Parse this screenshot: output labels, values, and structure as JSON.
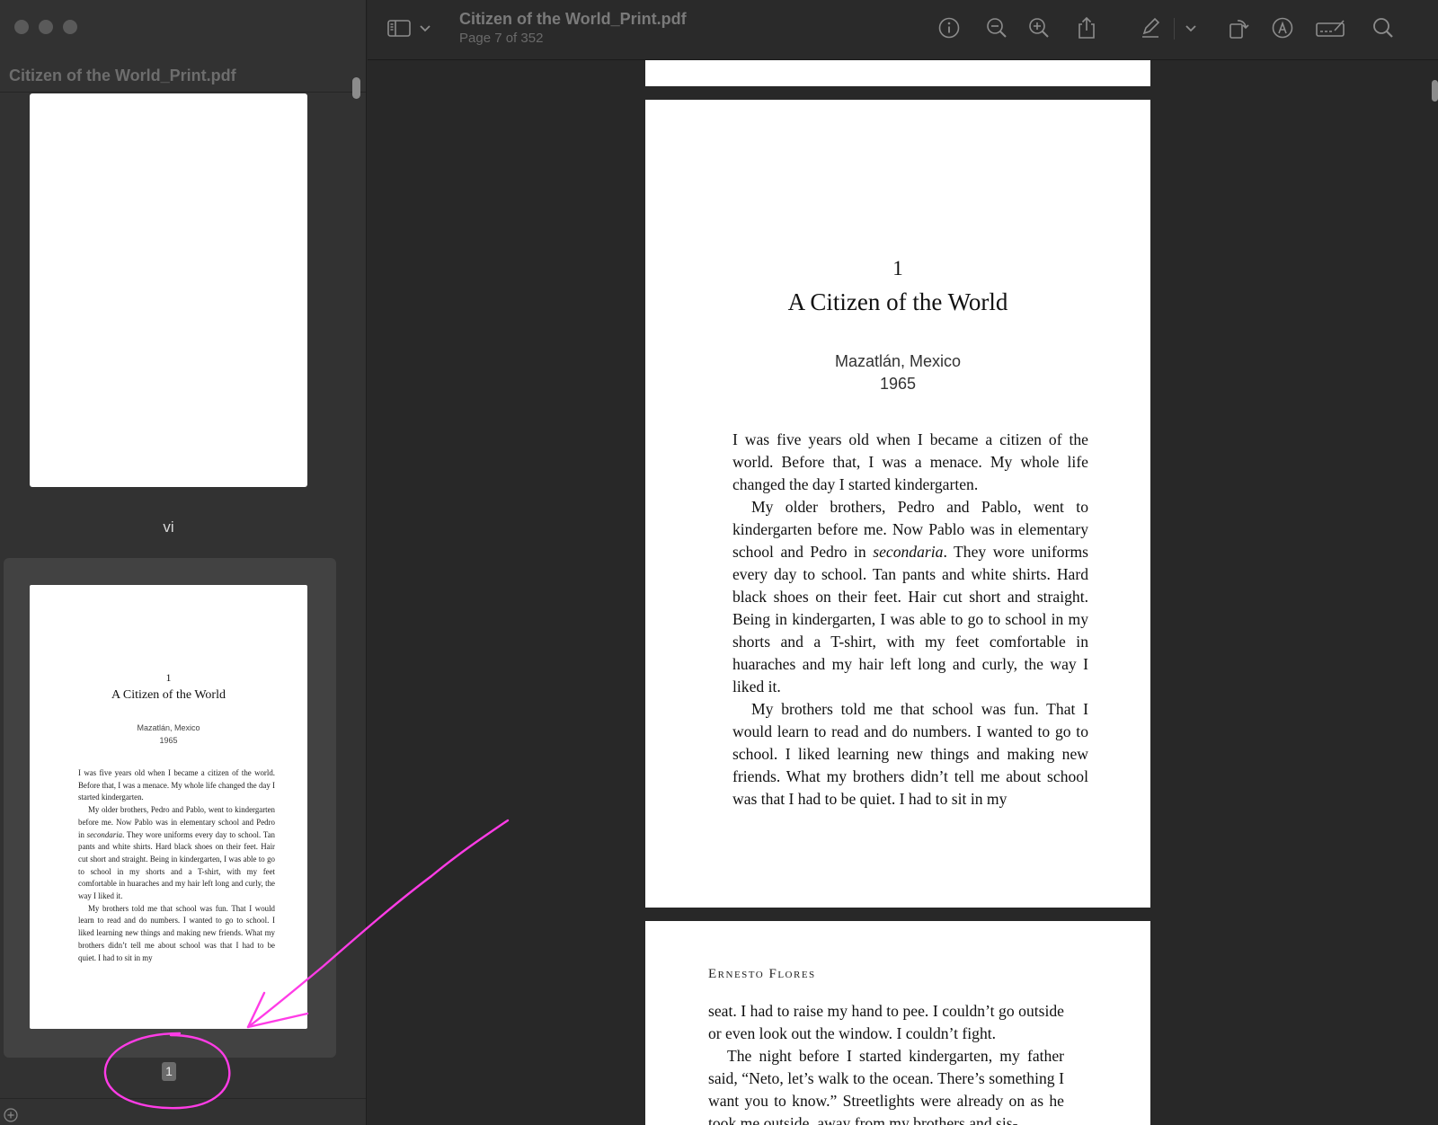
{
  "app": {
    "window_title": "Citizen of the World_Print.pdf",
    "page_indicator": "Page 7 of 352"
  },
  "sidebar": {
    "title": "Citizen of the World_Print.pdf",
    "thumbnails": [
      {
        "label": "vi"
      },
      {
        "label": "1",
        "selected": true,
        "chapter_number": "1",
        "chapter_title": "A Citizen of the World",
        "place": "Mazatlán, Mexico",
        "year": "1965"
      }
    ]
  },
  "toolbar": {
    "icons": [
      "sidebar-toggle-icon",
      "chevron-down-icon",
      "info-icon",
      "zoom-out-icon",
      "zoom-in-icon",
      "share-icon",
      "highlight-pen-icon",
      "chevron-down-icon",
      "rotate-icon",
      "markup-icon",
      "form-fill-icon",
      "search-icon"
    ]
  },
  "document": {
    "page": {
      "chapter_number": "1",
      "chapter_title": "A Citizen of the World",
      "place": "Mazatlán, Mexico",
      "year": "1965",
      "paragraph_1": "I was five years old when I became a citizen of the world. Before that, I was a menace. My whole life changed the day I started kindergarten.",
      "paragraph_2_start": "My older brothers, Pedro and Pablo, went to kindergarten before me. Now Pablo was in elementary school and Pedro in ",
      "paragraph_2_italic": "secondaria",
      "paragraph_2_end": ". They wore uniforms every day to school. Tan pants and white shirts. Hard black shoes on their feet. Hair cut short and straight. Being in kindergarten, I was able to go to school in my shorts and a T-shirt, with my feet comfortable in huaraches and my hair left long and curly, the way I liked it.",
      "paragraph_3": "My brothers told me that school was fun. That I would learn to read and do numbers. I wanted to go to school. I liked learning new things and making new friends. What my brothers didn’t tell me about school was that I had to be quiet. I had to sit in my"
    },
    "next_page": {
      "running_header": "Ernesto Flores",
      "paragraph_1": "seat. I had to raise my hand to pee. I couldn’t go outside or even look out the window. I couldn’t fight.",
      "paragraph_2": "The night before I started kindergarten, my father said, “Neto, let’s walk to the ocean. There’s something I want you to know.” Streetlights were already on as he took me outside, away from my brothers and sis-"
    }
  },
  "colors": {
    "annotation": "#ff3ce6",
    "background": "#282828",
    "sidebar": "#323232"
  }
}
